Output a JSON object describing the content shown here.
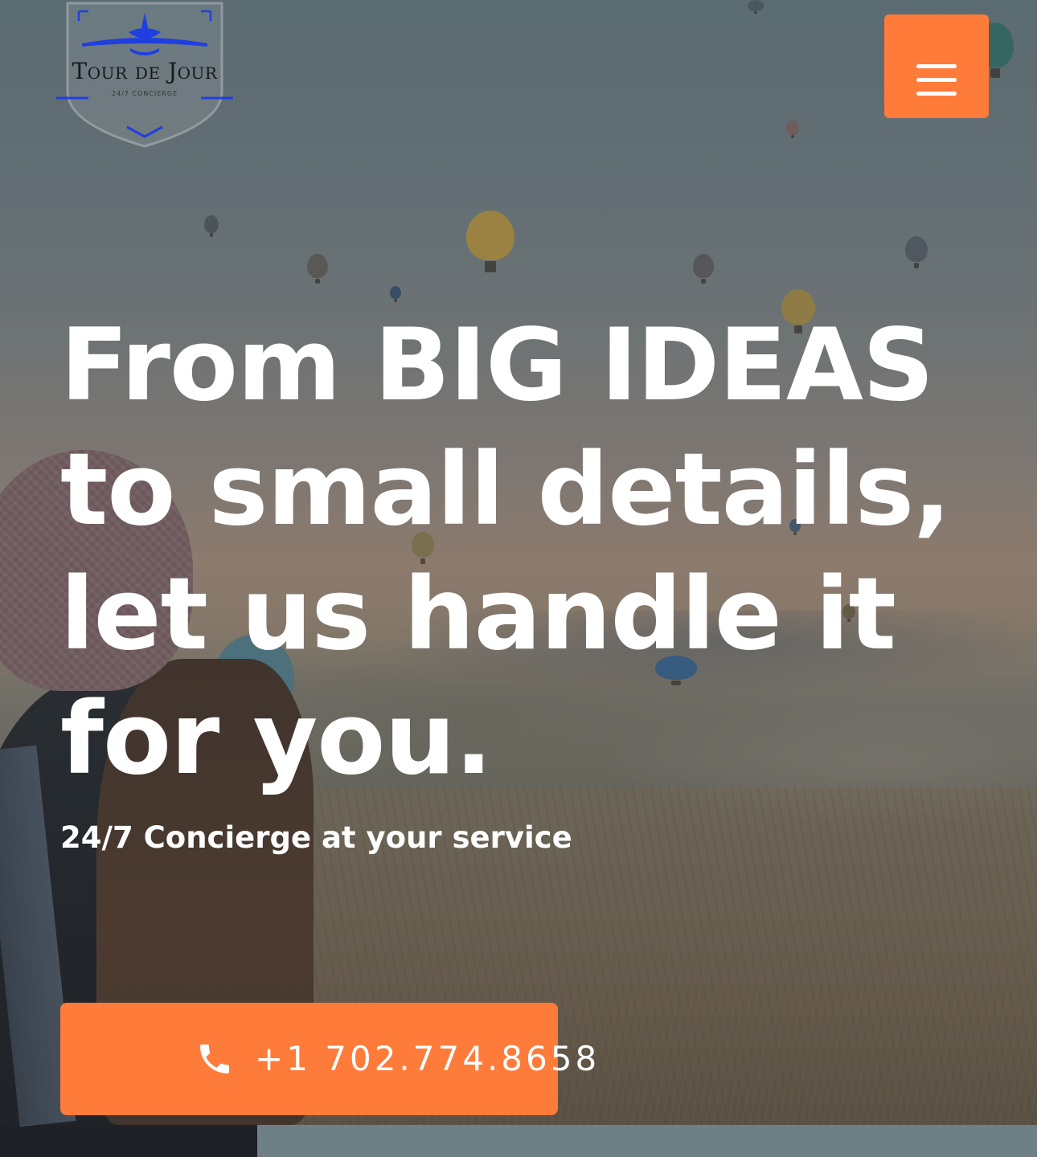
{
  "brand": {
    "name": "Tour de Jour",
    "tagline": "24/7 CONCIERGE"
  },
  "header": {
    "menu_icon": "hamburger-menu-icon"
  },
  "hero": {
    "headline_lines": [
      "From BIG IDEAS",
      "to small details,",
      "let us handle it",
      "for you."
    ],
    "subheading": "24/7 Concierge at your service",
    "cta": {
      "icon": "phone-icon",
      "label": "+1 702.774.8658"
    }
  },
  "colors": {
    "accent": "#ff7b3a",
    "text": "#ffffff",
    "logo_blue": "#1f3fe0"
  }
}
